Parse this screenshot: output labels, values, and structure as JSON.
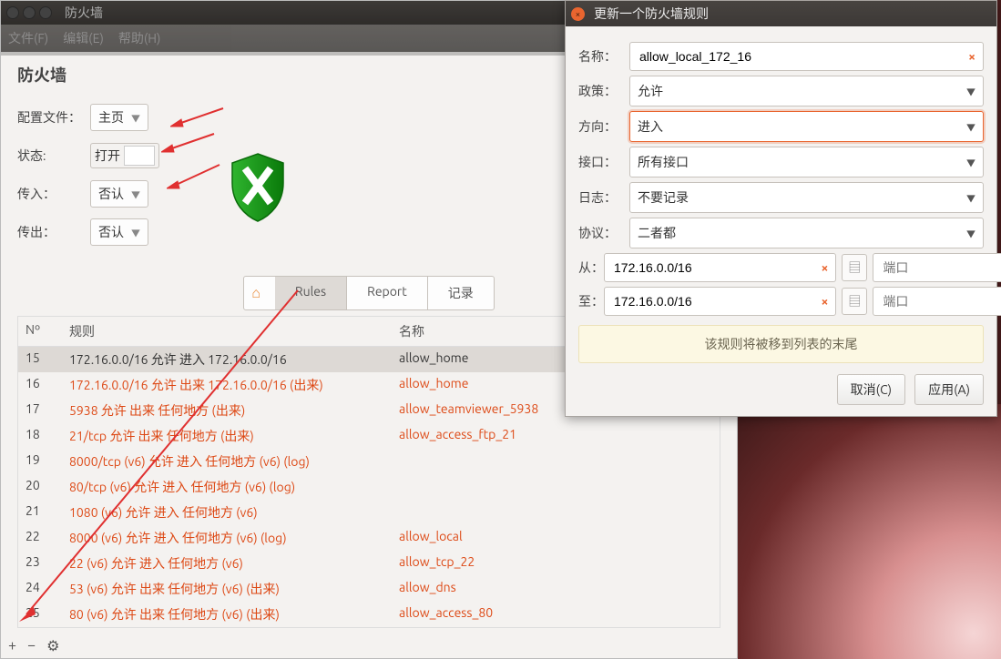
{
  "window": {
    "title": "防火墙",
    "menu": {
      "file": "文件(F)",
      "edit": "编辑(E)",
      "help": "帮助(H)"
    }
  },
  "panel": {
    "section_title": "防火墙",
    "labels": {
      "profile": "配置文件：",
      "status": "状态:",
      "incoming": "传入：",
      "outgoing": "传出："
    },
    "profile_value": "主页",
    "status_value": "打开",
    "incoming_value": "否认",
    "outgoing_value": "否认"
  },
  "tabs": {
    "rules": "Rules",
    "report": "Report",
    "log": "记录"
  },
  "table": {
    "headers": {
      "no": "Nº",
      "rule": "规则",
      "name": "名称"
    },
    "rows": [
      {
        "no": "15",
        "rule": "172.16.0.0/16 允许 进入 172.16.0.0/16",
        "name": "allow_home",
        "hl": true
      },
      {
        "no": "16",
        "rule": "172.16.0.0/16 允许 出来 172.16.0.0/16 (出来)",
        "name": "allow_home"
      },
      {
        "no": "17",
        "rule": "5938 允许 出来 任何地方 (出来)",
        "name": "allow_teamviewer_5938"
      },
      {
        "no": "18",
        "rule": "21/tcp 允许 出来 任何地方 (出来)",
        "name": "allow_access_ftp_21"
      },
      {
        "no": "19",
        "rule": "8000/tcp (v6) 允许 进入 任何地方 (v6) (log)",
        "name": ""
      },
      {
        "no": "20",
        "rule": "80/tcp (v6) 允许 进入 任何地方 (v6) (log)",
        "name": ""
      },
      {
        "no": "21",
        "rule": "1080 (v6) 允许 进入 任何地方 (v6)",
        "name": ""
      },
      {
        "no": "22",
        "rule": "8000 (v6) 允许 进入 任何地方 (v6) (log)",
        "name": "allow_local"
      },
      {
        "no": "23",
        "rule": "22 (v6) 允许 进入 任何地方 (v6)",
        "name": "allow_tcp_22"
      },
      {
        "no": "24",
        "rule": "53 (v6) 允许 出来 任何地方 (v6) (出来)",
        "name": "allow_dns"
      },
      {
        "no": "25",
        "rule": "80 (v6) 允许 出来 任何地方 (v6) (出来)",
        "name": "allow_access_80"
      }
    ]
  },
  "toolbar": {
    "add": "+",
    "remove": "−",
    "settings": "⚙"
  },
  "dialog": {
    "title": "更新一个防火墙规则",
    "labels": {
      "name": "名称：",
      "policy": "政策：",
      "direction": "方向：",
      "iface": "接口：",
      "log": "日志：",
      "proto": "协议：",
      "from": "从：",
      "to": "至："
    },
    "values": {
      "name": "allow_local_172_16",
      "policy": "允许",
      "direction": "进入",
      "iface": "所有接口",
      "log": "不要记录",
      "proto": "二者都",
      "from_ip": "172.16.0.0/16",
      "to_ip": "172.16.0.0/16",
      "port_ph": "端口"
    },
    "note": "该规则将被移到列表的末尾",
    "cancel": "取消(C)",
    "apply": "应用(A)"
  }
}
